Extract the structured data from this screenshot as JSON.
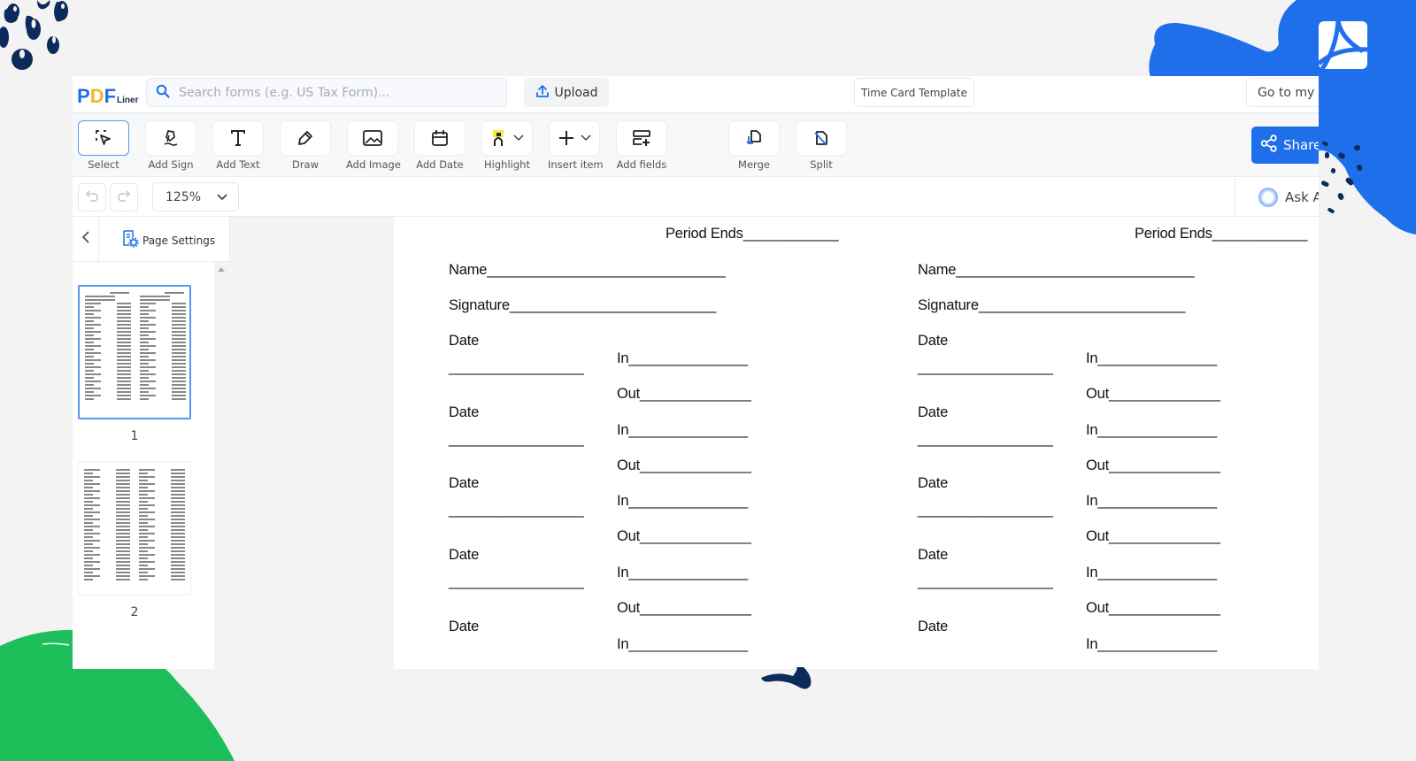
{
  "app": {
    "logo": {
      "part1": "P",
      "part2": "D",
      "part3": "F",
      "suffix": "Liner"
    },
    "search": {
      "placeholder": "Search forms (e.g. US Tax Form)...",
      "value": ""
    },
    "upload_label": "Upload",
    "document_title": "Time Card Template",
    "goto_label": "Go to my",
    "share_label": "Share",
    "ask_label": "Ask A"
  },
  "toolbar": {
    "tools": [
      {
        "id": "select",
        "label": "Select",
        "icon": "select-icon",
        "active": true
      },
      {
        "id": "add-sign",
        "label": "Add Sign",
        "icon": "signature-icon"
      },
      {
        "id": "add-text",
        "label": "Add Text",
        "icon": "text-icon"
      },
      {
        "id": "draw",
        "label": "Draw",
        "icon": "pen-icon"
      },
      {
        "id": "add-image",
        "label": "Add Image",
        "icon": "image-icon"
      },
      {
        "id": "add-date",
        "label": "Add Date",
        "icon": "calendar-icon"
      },
      {
        "id": "highlight",
        "label": "Highlight",
        "icon": "highlighter-icon"
      },
      {
        "id": "insert-item",
        "label": "Insert item",
        "icon": "plus-icon"
      },
      {
        "id": "add-fields",
        "label": "Add fields",
        "icon": "add-fields-icon"
      },
      {
        "id": "merge",
        "label": "Merge",
        "icon": "merge-icon"
      },
      {
        "id": "split",
        "label": "Split",
        "icon": "split-icon"
      }
    ]
  },
  "viewer": {
    "zoom_level": "125%",
    "page_settings_label": "Page Settings",
    "pages": [
      {
        "number": "1",
        "selected": true
      },
      {
        "number": "2",
        "selected": false
      }
    ]
  },
  "document": {
    "columns": [
      {
        "period_ends": "Period Ends____________",
        "name": "Name______________________________",
        "signature": "Signature__________________________",
        "date_label": "Date",
        "date_blank": "_________________",
        "in_field": "In_______________",
        "out_field": "Out______________"
      },
      {
        "period_ends": "Period Ends____________",
        "name": "Name______________________________",
        "signature": "Signature__________________________",
        "date_label": "Date",
        "date_blank": "_________________",
        "in_field": "In_______________",
        "out_field": "Out______________"
      }
    ]
  },
  "colors": {
    "brand_blue": "#1f6fea",
    "brand_yellow": "#f7b52b",
    "deco_navy": "#0d2a5c",
    "deco_green": "#1dbf5b"
  }
}
